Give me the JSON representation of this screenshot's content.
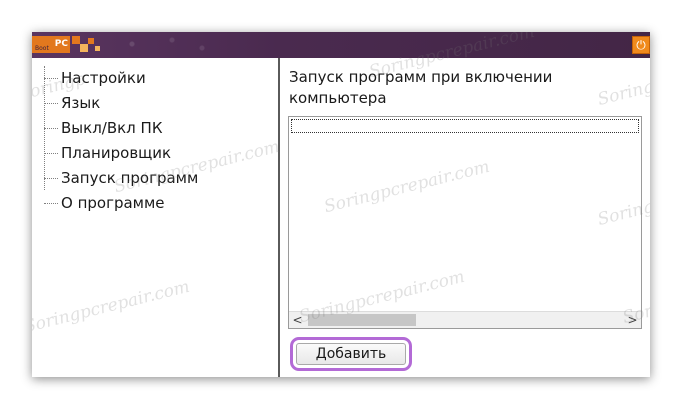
{
  "window": {
    "logo_text": "PC",
    "logo_script": "Boot",
    "power_icon": "⏻"
  },
  "sidebar": {
    "items": [
      {
        "label": "Настройки"
      },
      {
        "label": "Язык"
      },
      {
        "label": "Выкл/Вкл ПК"
      },
      {
        "label": "Планировщик"
      },
      {
        "label": "Запуск программ"
      },
      {
        "label": "О программе"
      }
    ]
  },
  "main": {
    "heading": "Запуск программ при включении компьютера",
    "scroll_left": "<",
    "scroll_right": ">",
    "add_button_label": "Добавить"
  },
  "watermark": {
    "text_a": "Soringpcrepair.com",
    "text_b": "Soringp"
  },
  "colors": {
    "titlebar": "#4a2a4f",
    "accent_orange": "#e2781e",
    "button_highlight": "#b36ad6"
  }
}
